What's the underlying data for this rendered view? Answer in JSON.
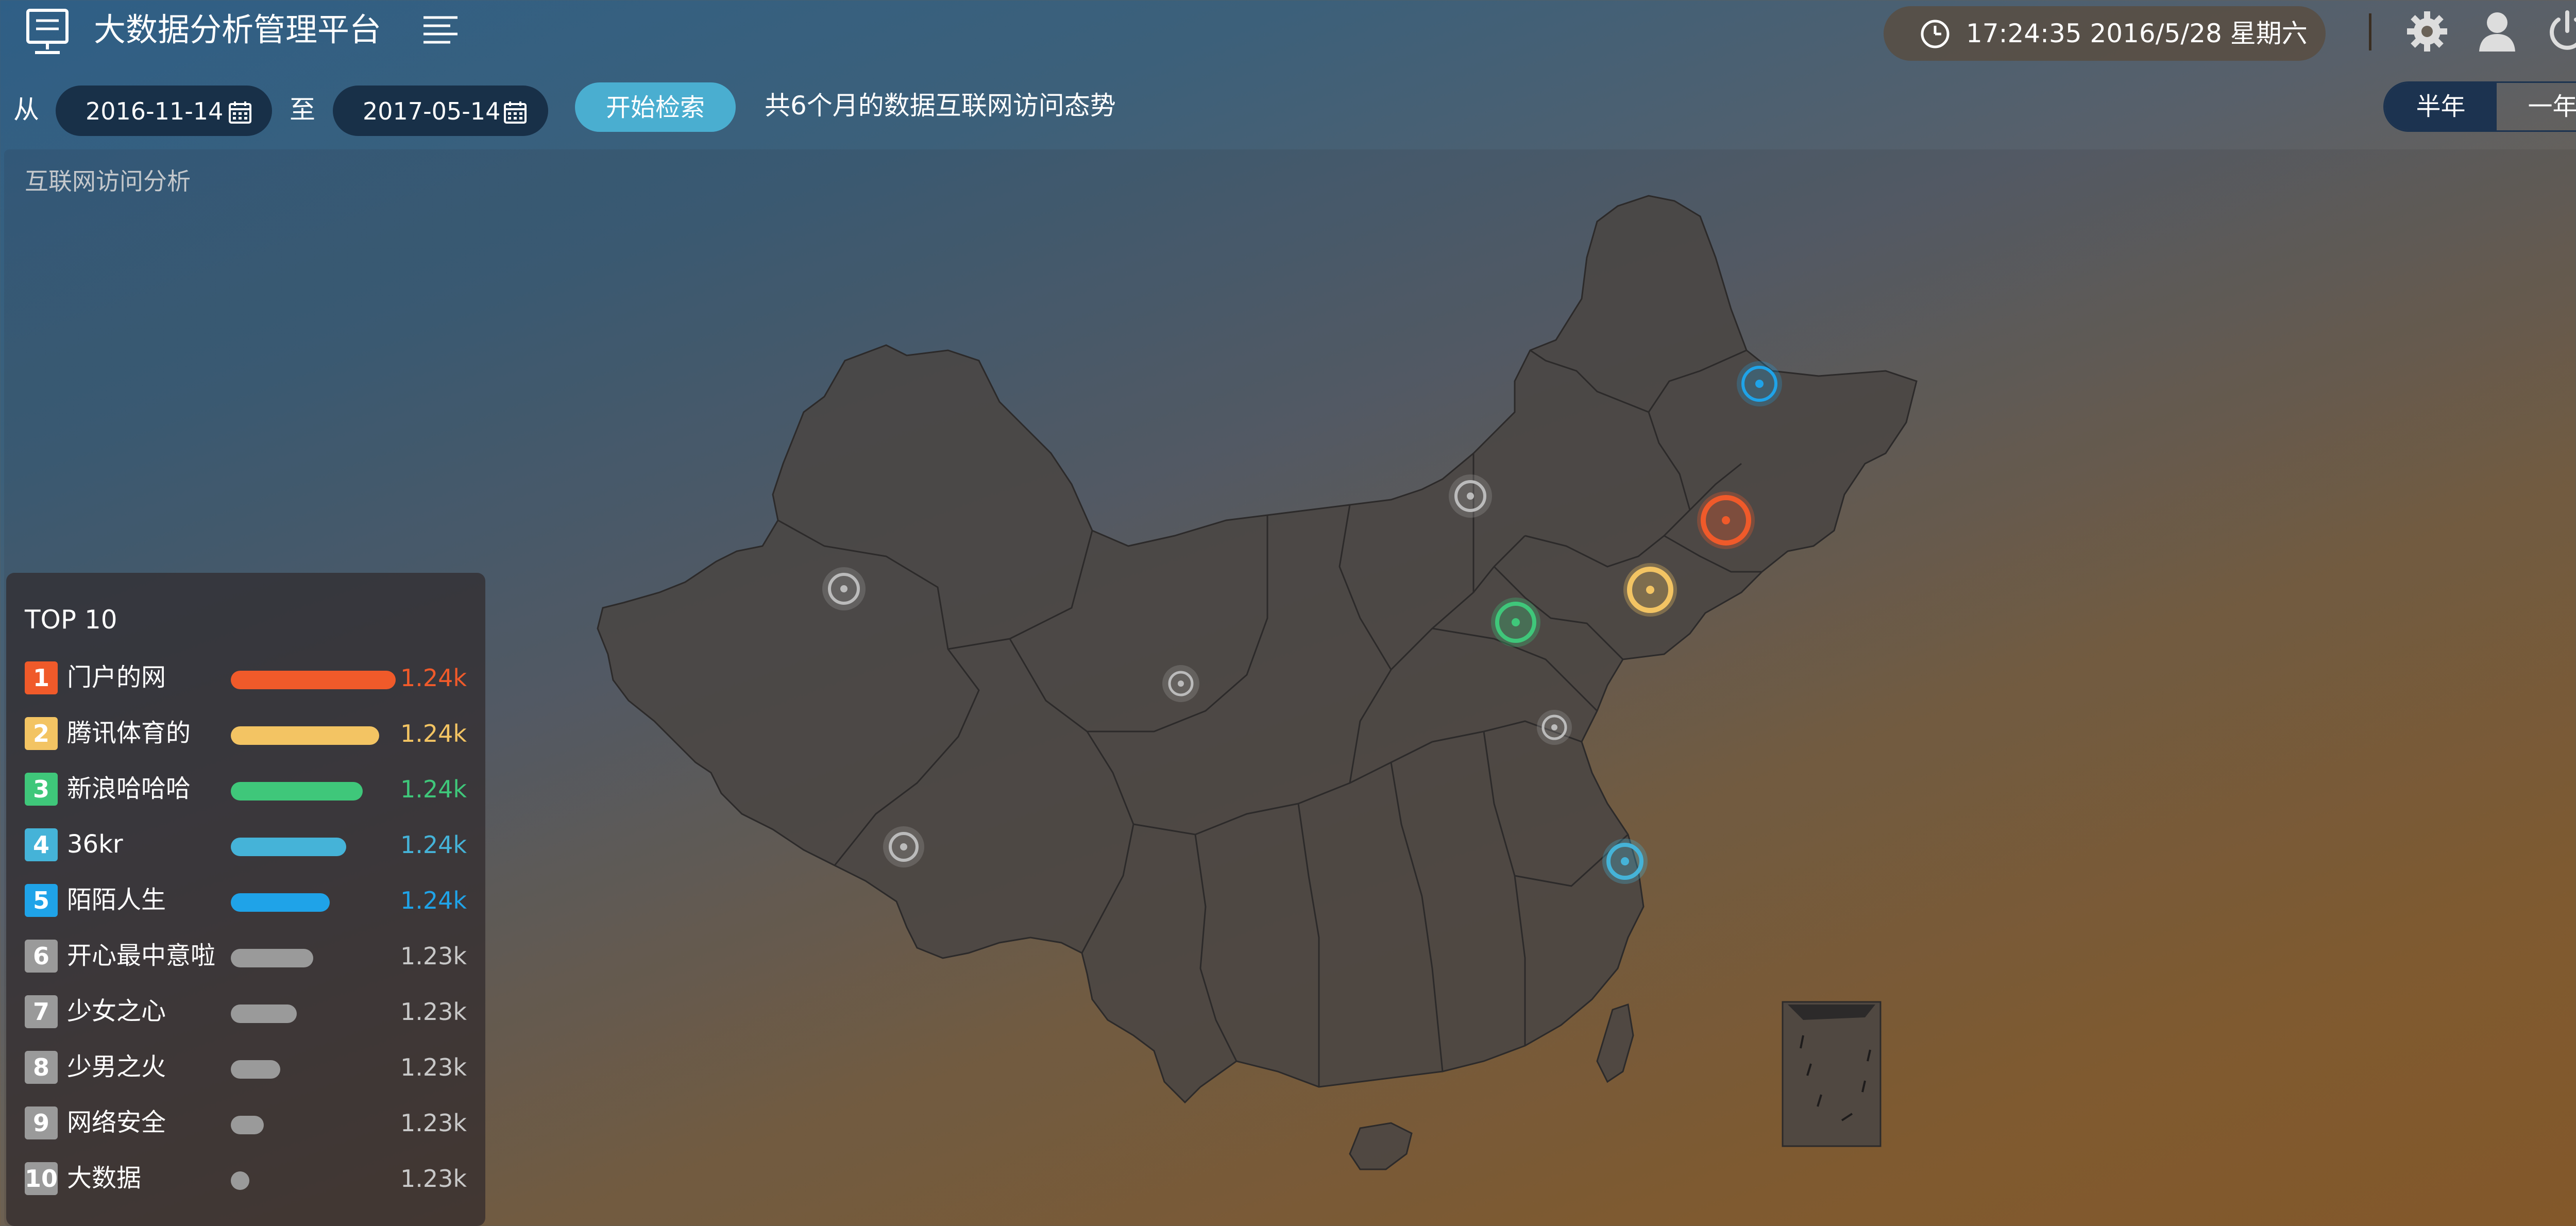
{
  "header": {
    "app_title": "大数据分析管理平台",
    "clock_text": "17:24:35  2016/5/28 星期六",
    "icons": [
      "monitor-icon",
      "menu-icon",
      "clock-icon",
      "gear-icon",
      "user-icon",
      "power-icon"
    ]
  },
  "filter": {
    "from_label": "从",
    "start_date": "2016-11-14",
    "to_label": "至",
    "end_date": "2017-05-14",
    "search_button": "开始检索",
    "summary": "共6个月的数据互联网访问态势",
    "range_options": [
      "半年",
      "一年"
    ],
    "selected_range": "半年"
  },
  "panel": {
    "title": "互联网访问分析"
  },
  "top10": {
    "title": "TOP 10",
    "items": [
      {
        "rank": "1",
        "name": "门户的网",
        "value": "1.24k",
        "color": "#f05a2a",
        "bar": 1.0
      },
      {
        "rank": "2",
        "name": "腾讯体育的",
        "value": "1.24k",
        "color": "#f3c463",
        "bar": 0.9
      },
      {
        "rank": "3",
        "name": "新浪哈哈哈",
        "value": "1.24k",
        "color": "#3fc77a",
        "bar": 0.8
      },
      {
        "rank": "4",
        "name": "36kr",
        "value": "1.24k",
        "color": "#45b3d8",
        "bar": 0.7
      },
      {
        "rank": "5",
        "name": "陌陌人生",
        "value": "1.24k",
        "color": "#1fa3e8",
        "bar": 0.6
      },
      {
        "rank": "6",
        "name": "开心最中意啦",
        "value": "1.23k",
        "color": "#9a9a9a",
        "bar": 0.5
      },
      {
        "rank": "7",
        "name": "少女之心",
        "value": "1.23k",
        "color": "#9a9a9a",
        "bar": 0.4
      },
      {
        "rank": "8",
        "name": "少男之火",
        "value": "1.23k",
        "color": "#9a9a9a",
        "bar": 0.3
      },
      {
        "rank": "9",
        "name": "网络安全",
        "value": "1.23k",
        "color": "#9a9a9a",
        "bar": 0.2
      },
      {
        "rank": "10",
        "name": "大数据",
        "value": "1.23k",
        "color": "#9a9a9a",
        "bar": 0.05
      }
    ],
    "value_colors": [
      "#f05a2a",
      "#f3c463",
      "#3fc77a",
      "#45b3d8",
      "#1fa3e8",
      "#c8c8c8",
      "#c8c8c8",
      "#c8c8c8",
      "#c8c8c8",
      "#c8c8c8"
    ]
  },
  "map": {
    "markers": [
      {
        "color": "#1fa3e8"
      },
      {
        "color": "#f05a2a"
      },
      {
        "color": "#f3c463"
      },
      {
        "color": "#3fc77a"
      },
      {
        "color": "#45b3d8"
      },
      {
        "color": "#bbbbbb"
      },
      {
        "color": "#bbbbbb"
      },
      {
        "color": "#bbbbbb"
      },
      {
        "color": "#bbbbbb"
      },
      {
        "color": "#bbbbbb"
      }
    ]
  }
}
